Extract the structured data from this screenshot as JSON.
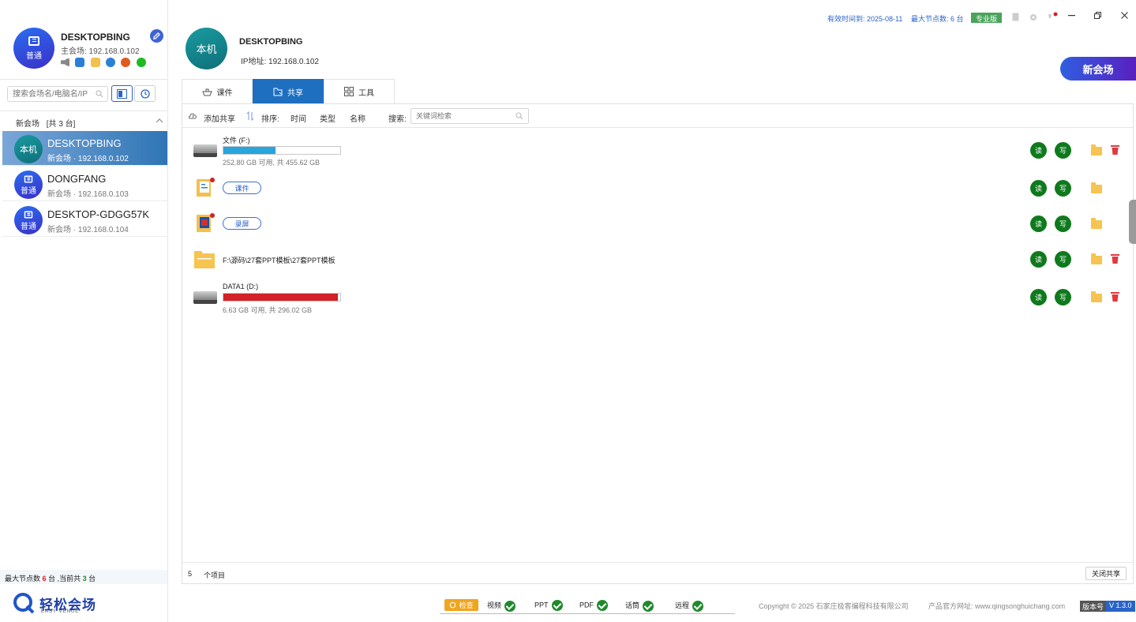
{
  "profile": {
    "avatar_label": "普通",
    "name": "DESKTOPBING",
    "host_line": "主会场: 192.168.0.102"
  },
  "sidebar": {
    "search_placeholder": "搜索会场名/电脑名/IP",
    "group_title": "新会场",
    "group_count": "[共 3 台]",
    "nodes": [
      {
        "avatar_label": "本机",
        "name": "DESKTOPBING",
        "sub": "新会场 · 192.168.0.102"
      },
      {
        "avatar_label": "普通",
        "name": "DONGFANG",
        "sub": "新会场 · 192.168.0.103"
      },
      {
        "avatar_label": "普通",
        "name": "DESKTOP-GDGG57K",
        "sub": "新会场 · 192.168.0.104"
      }
    ],
    "footer": {
      "prefix": "最大节点数",
      "max": "6",
      "mid": "台 ,当前共",
      "current": "3",
      "suffix": "台"
    }
  },
  "logo": {
    "text": "轻松会场",
    "sub": "EASY VENUE"
  },
  "header": {
    "avatar_label": "本机",
    "name": "DESKTOPBING",
    "ip_line": "IP地址: 192.168.0.102",
    "valid_until": "有效时间到: 2025-08-11",
    "max_nodes": "最大节点数: 6 台",
    "edition": "专业版",
    "new_venue_button": "新会场"
  },
  "tabs": [
    {
      "label": "课件"
    },
    {
      "label": "共享"
    },
    {
      "label": "工具"
    }
  ],
  "toolbar": {
    "add_share": "添加共享",
    "sort_label": "排序:",
    "sort_time": "时间",
    "sort_type": "类型",
    "sort_name": "名称",
    "search_label": "搜索:",
    "search_placeholder": "关键词检索"
  },
  "shares": [
    {
      "kind": "drive",
      "title": "文件 (F:)",
      "usage": "252.80 GB 可用, 共 455.62 GB",
      "used_fraction": 0.445,
      "bar_color": "#2aa4dc",
      "read": "读",
      "write": "写",
      "deletable": true
    },
    {
      "kind": "tag",
      "tag": "课件",
      "read": "读",
      "write": "写",
      "deletable": false
    },
    {
      "kind": "tag",
      "tag": "录屏",
      "read": "读",
      "write": "写",
      "deletable": false
    },
    {
      "kind": "folder",
      "title": "F:\\源码\\27套PPT模板\\27套PPT模板",
      "read": "读",
      "write": "写",
      "deletable": true
    },
    {
      "kind": "drive",
      "title": "DATA1 (D:)",
      "usage": "6.63 GB 可用, 共 296.02 GB",
      "used_fraction": 0.978,
      "bar_color": "#d42027",
      "read": "读",
      "write": "写",
      "deletable": true
    }
  ],
  "status": {
    "count": "5",
    "items_label": "个项目",
    "close_share": "关闭共享"
  },
  "checks": {
    "button": "检查",
    "items": [
      "视频",
      "PPT",
      "PDF",
      "话筒",
      "远程"
    ]
  },
  "copyright": "Copyright © 2025 石家庄极客编程科技有限公司",
  "website": "产品官方网址: www.qingsonghuichang.com",
  "version": {
    "label": "版本号",
    "value": "V 1.3.0"
  }
}
